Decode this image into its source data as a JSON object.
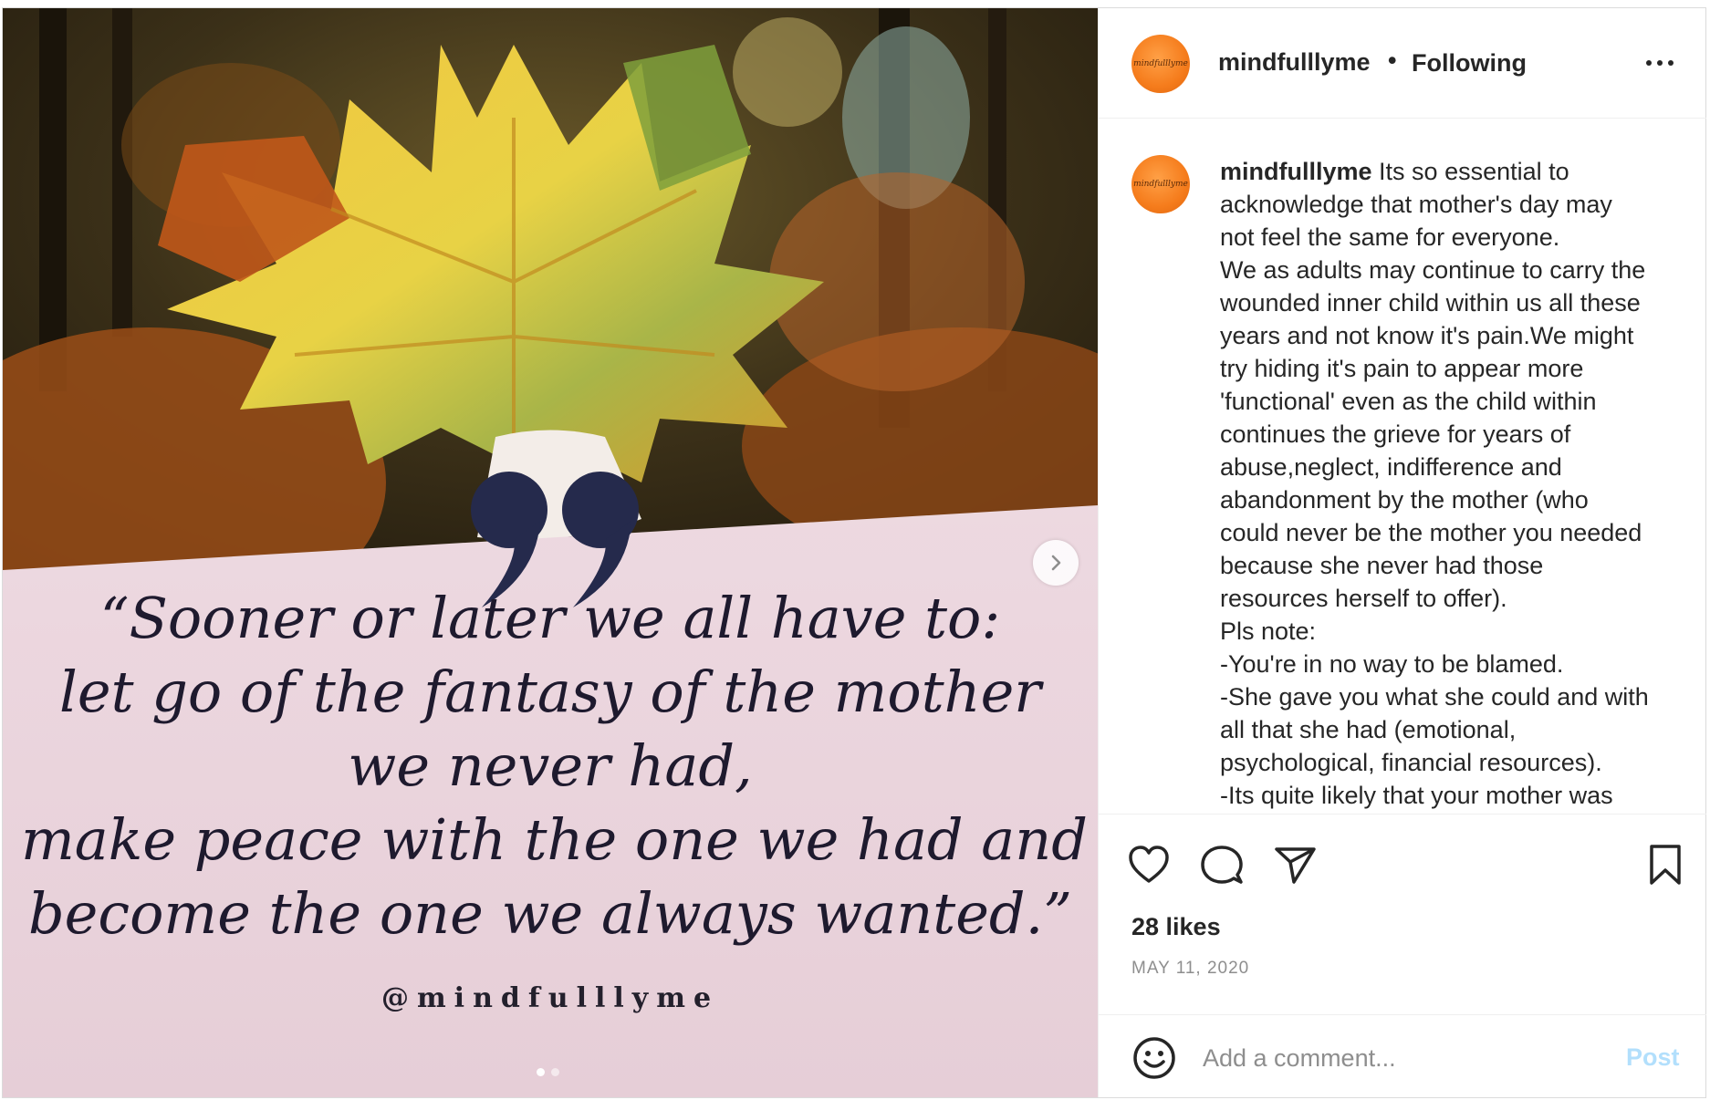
{
  "post": {
    "image": {
      "quote_lines": [
        "“Sooner or later we all have to:",
        "let go of the fantasy of the mother",
        "we never had,",
        "make peace with the one we had and",
        "become the one we always wanted.”"
      ],
      "handle": "@mindfulllyme",
      "carousel": {
        "total": 2,
        "current": 1
      }
    },
    "header": {
      "username": "mindfulllyme",
      "separator": "•",
      "follow_status": "Following",
      "avatar_text": "mindfulllyme"
    },
    "caption": {
      "username": "mindfulllyme",
      "lines": [
        "Its so essential to",
        "acknowledge that mother's day may",
        "not feel the same for everyone.",
        "We as adults may continue to carry the",
        "wounded inner child within us all these",
        "years and not know it's pain.We might",
        "try hiding it's pain to appear more",
        "'functional' even as the child within",
        "continues the grieve for years of",
        "abuse,neglect, indifference and",
        "abandonment by the mother (who",
        "could never be the mother you needed",
        "because she never had those",
        "resources herself to offer).",
        "Pls note:",
        "-You're in no way to be blamed.",
        "-She gave you what she could and with",
        "all that she had (emotional,",
        "psychological, financial resources).",
        "-Its quite likely that your mother was"
      ]
    },
    "likes": "28 likes",
    "date": "MAY 11, 2020",
    "comment": {
      "placeholder": "Add a comment...",
      "post_label": "Post"
    },
    "icons": {
      "like": "heart-icon",
      "comment": "comment-icon",
      "share": "paper-plane-icon",
      "save": "bookmark-icon",
      "more": "more-horizontal-icon",
      "emoji": "smiley-icon",
      "next": "chevron-right-icon"
    },
    "colors": {
      "avatar_orange": "#f57c1c",
      "post_button_disabled": "#b2dffc",
      "quote_text": "#1e1a2e",
      "quote_panel": "#ecd7df"
    }
  }
}
